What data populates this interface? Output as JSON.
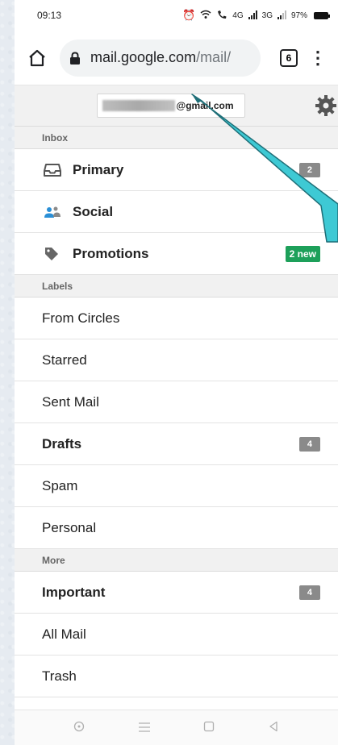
{
  "status": {
    "time": "09:13",
    "network_a": "4G",
    "network_b": "3G",
    "battery": "97%"
  },
  "browser": {
    "url_host": "mail.google.com",
    "url_path": "/mail/",
    "tab_count": "6"
  },
  "account": {
    "email_suffix": "@gmail.com"
  },
  "sections": {
    "inbox": "Inbox",
    "labels": "Labels",
    "more": "More"
  },
  "inbox_items": [
    {
      "label": "Primary",
      "icon": "inbox-icon",
      "badge": "2"
    },
    {
      "label": "Social",
      "icon": "people-icon",
      "badge": ""
    },
    {
      "label": "Promotions",
      "icon": "tag-icon",
      "badge": "2 new"
    }
  ],
  "label_items": [
    {
      "label": "From Circles",
      "badge": ""
    },
    {
      "label": "Starred",
      "badge": ""
    },
    {
      "label": "Sent Mail",
      "badge": ""
    },
    {
      "label": "Drafts",
      "badge": "4"
    },
    {
      "label": "Spam",
      "badge": ""
    },
    {
      "label": "Personal",
      "badge": ""
    }
  ],
  "more_items": [
    {
      "label": "Important",
      "badge": "4"
    },
    {
      "label": "All Mail",
      "badge": ""
    },
    {
      "label": "Trash",
      "badge": ""
    }
  ],
  "colors": {
    "promo_badge": "#1da05a",
    "count_badge": "#8a8a8a",
    "annotation_arrow": "#3ec9d4"
  }
}
